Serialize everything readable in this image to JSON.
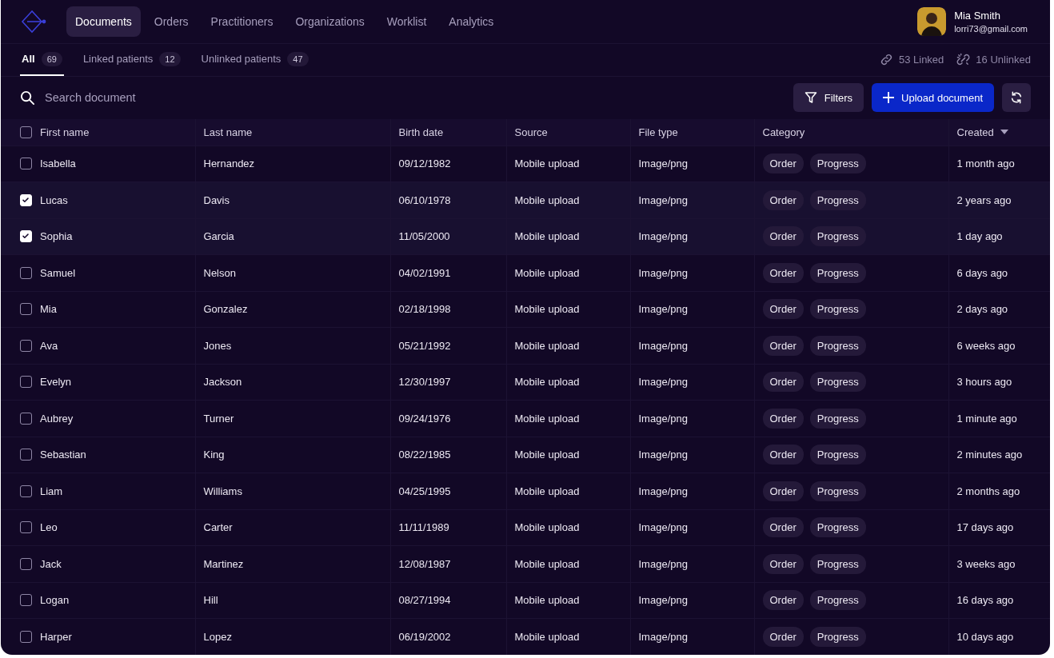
{
  "nav": {
    "items": [
      {
        "label": "Documents",
        "selected": true
      },
      {
        "label": "Orders",
        "selected": false
      },
      {
        "label": "Practitioners",
        "selected": false
      },
      {
        "label": "Organizations",
        "selected": false
      },
      {
        "label": "Worklist",
        "selected": false
      },
      {
        "label": "Analytics",
        "selected": false
      }
    ]
  },
  "user": {
    "name": "Mia Smith",
    "email": "lorri73@gmail.com"
  },
  "tabs": [
    {
      "label": "All",
      "count": "69",
      "selected": true
    },
    {
      "label": "Linked patients",
      "count": "12",
      "selected": false
    },
    {
      "label": "Unlinked patients",
      "count": "47",
      "selected": false
    }
  ],
  "stats": [
    {
      "kind": "linked",
      "label": "53 Linked"
    },
    {
      "kind": "unlinked",
      "label": "16 Unlinked"
    }
  ],
  "search": {
    "placeholder": "Search document"
  },
  "buttons": {
    "filters": "Filters",
    "upload": "Upload document"
  },
  "table": {
    "all_selected": false,
    "columns": [
      "First name",
      "Last name",
      "Birth date",
      "Source",
      "File type",
      "Category",
      "Created"
    ],
    "rows": [
      {
        "selected": false,
        "cells": [
          "Isabella",
          "Hernandez",
          "09/12/1982",
          "Mobile upload",
          "Image/png"
        ],
        "tags": [
          "Order",
          "Progress"
        ],
        "created": "1 month ago"
      },
      {
        "selected": true,
        "cells": [
          "Lucas",
          "Davis",
          "06/10/1978",
          "Mobile upload",
          "Image/png"
        ],
        "tags": [
          "Order",
          "Progress"
        ],
        "created": "2 years ago"
      },
      {
        "selected": true,
        "cells": [
          "Sophia",
          "Garcia",
          "11/05/2000",
          "Mobile upload",
          "Image/png"
        ],
        "tags": [
          "Order",
          "Progress"
        ],
        "created": "1 day ago"
      },
      {
        "selected": false,
        "cells": [
          "Samuel",
          "Nelson",
          "04/02/1991",
          "Mobile upload",
          "Image/png"
        ],
        "tags": [
          "Order",
          "Progress"
        ],
        "created": "6 days ago"
      },
      {
        "selected": false,
        "cells": [
          "Mia",
          "Gonzalez",
          "02/18/1998",
          "Mobile upload",
          "Image/png"
        ],
        "tags": [
          "Order",
          "Progress"
        ],
        "created": "2 days ago"
      },
      {
        "selected": false,
        "cells": [
          "Ava",
          "Jones",
          "05/21/1992",
          "Mobile upload",
          "Image/png"
        ],
        "tags": [
          "Order",
          "Progress"
        ],
        "created": "6 weeks ago"
      },
      {
        "selected": false,
        "cells": [
          "Evelyn",
          "Jackson",
          "12/30/1997",
          "Mobile upload",
          "Image/png"
        ],
        "tags": [
          "Order",
          "Progress"
        ],
        "created": "3 hours ago"
      },
      {
        "selected": false,
        "cells": [
          "Aubrey",
          "Turner",
          "09/24/1976",
          "Mobile upload",
          "Image/png"
        ],
        "tags": [
          "Order",
          "Progress"
        ],
        "created": "1 minute ago"
      },
      {
        "selected": false,
        "cells": [
          "Sebastian",
          "King",
          "08/22/1985",
          "Mobile upload",
          "Image/png"
        ],
        "tags": [
          "Order",
          "Progress"
        ],
        "created": "2 minutes ago"
      },
      {
        "selected": false,
        "cells": [
          "Liam",
          "Williams",
          "04/25/1995",
          "Mobile upload",
          "Image/png"
        ],
        "tags": [
          "Order",
          "Progress"
        ],
        "created": "2 months ago"
      },
      {
        "selected": false,
        "cells": [
          "Leo",
          "Carter",
          "11/11/1989",
          "Mobile upload",
          "Image/png"
        ],
        "tags": [
          "Order",
          "Progress"
        ],
        "created": "17 days ago"
      },
      {
        "selected": false,
        "cells": [
          "Jack",
          "Martinez",
          "12/08/1987",
          "Mobile upload",
          "Image/png"
        ],
        "tags": [
          "Order",
          "Progress"
        ],
        "created": "3 weeks ago"
      },
      {
        "selected": false,
        "cells": [
          "Logan",
          "Hill",
          "08/27/1994",
          "Mobile upload",
          "Image/png"
        ],
        "tags": [
          "Order",
          "Progress"
        ],
        "created": "16 days ago"
      },
      {
        "selected": false,
        "cells": [
          "Harper",
          "Lopez",
          "06/19/2002",
          "Mobile upload",
          "Image/png"
        ],
        "tags": [
          "Order",
          "Progress"
        ],
        "created": "10 days ago"
      }
    ]
  }
}
